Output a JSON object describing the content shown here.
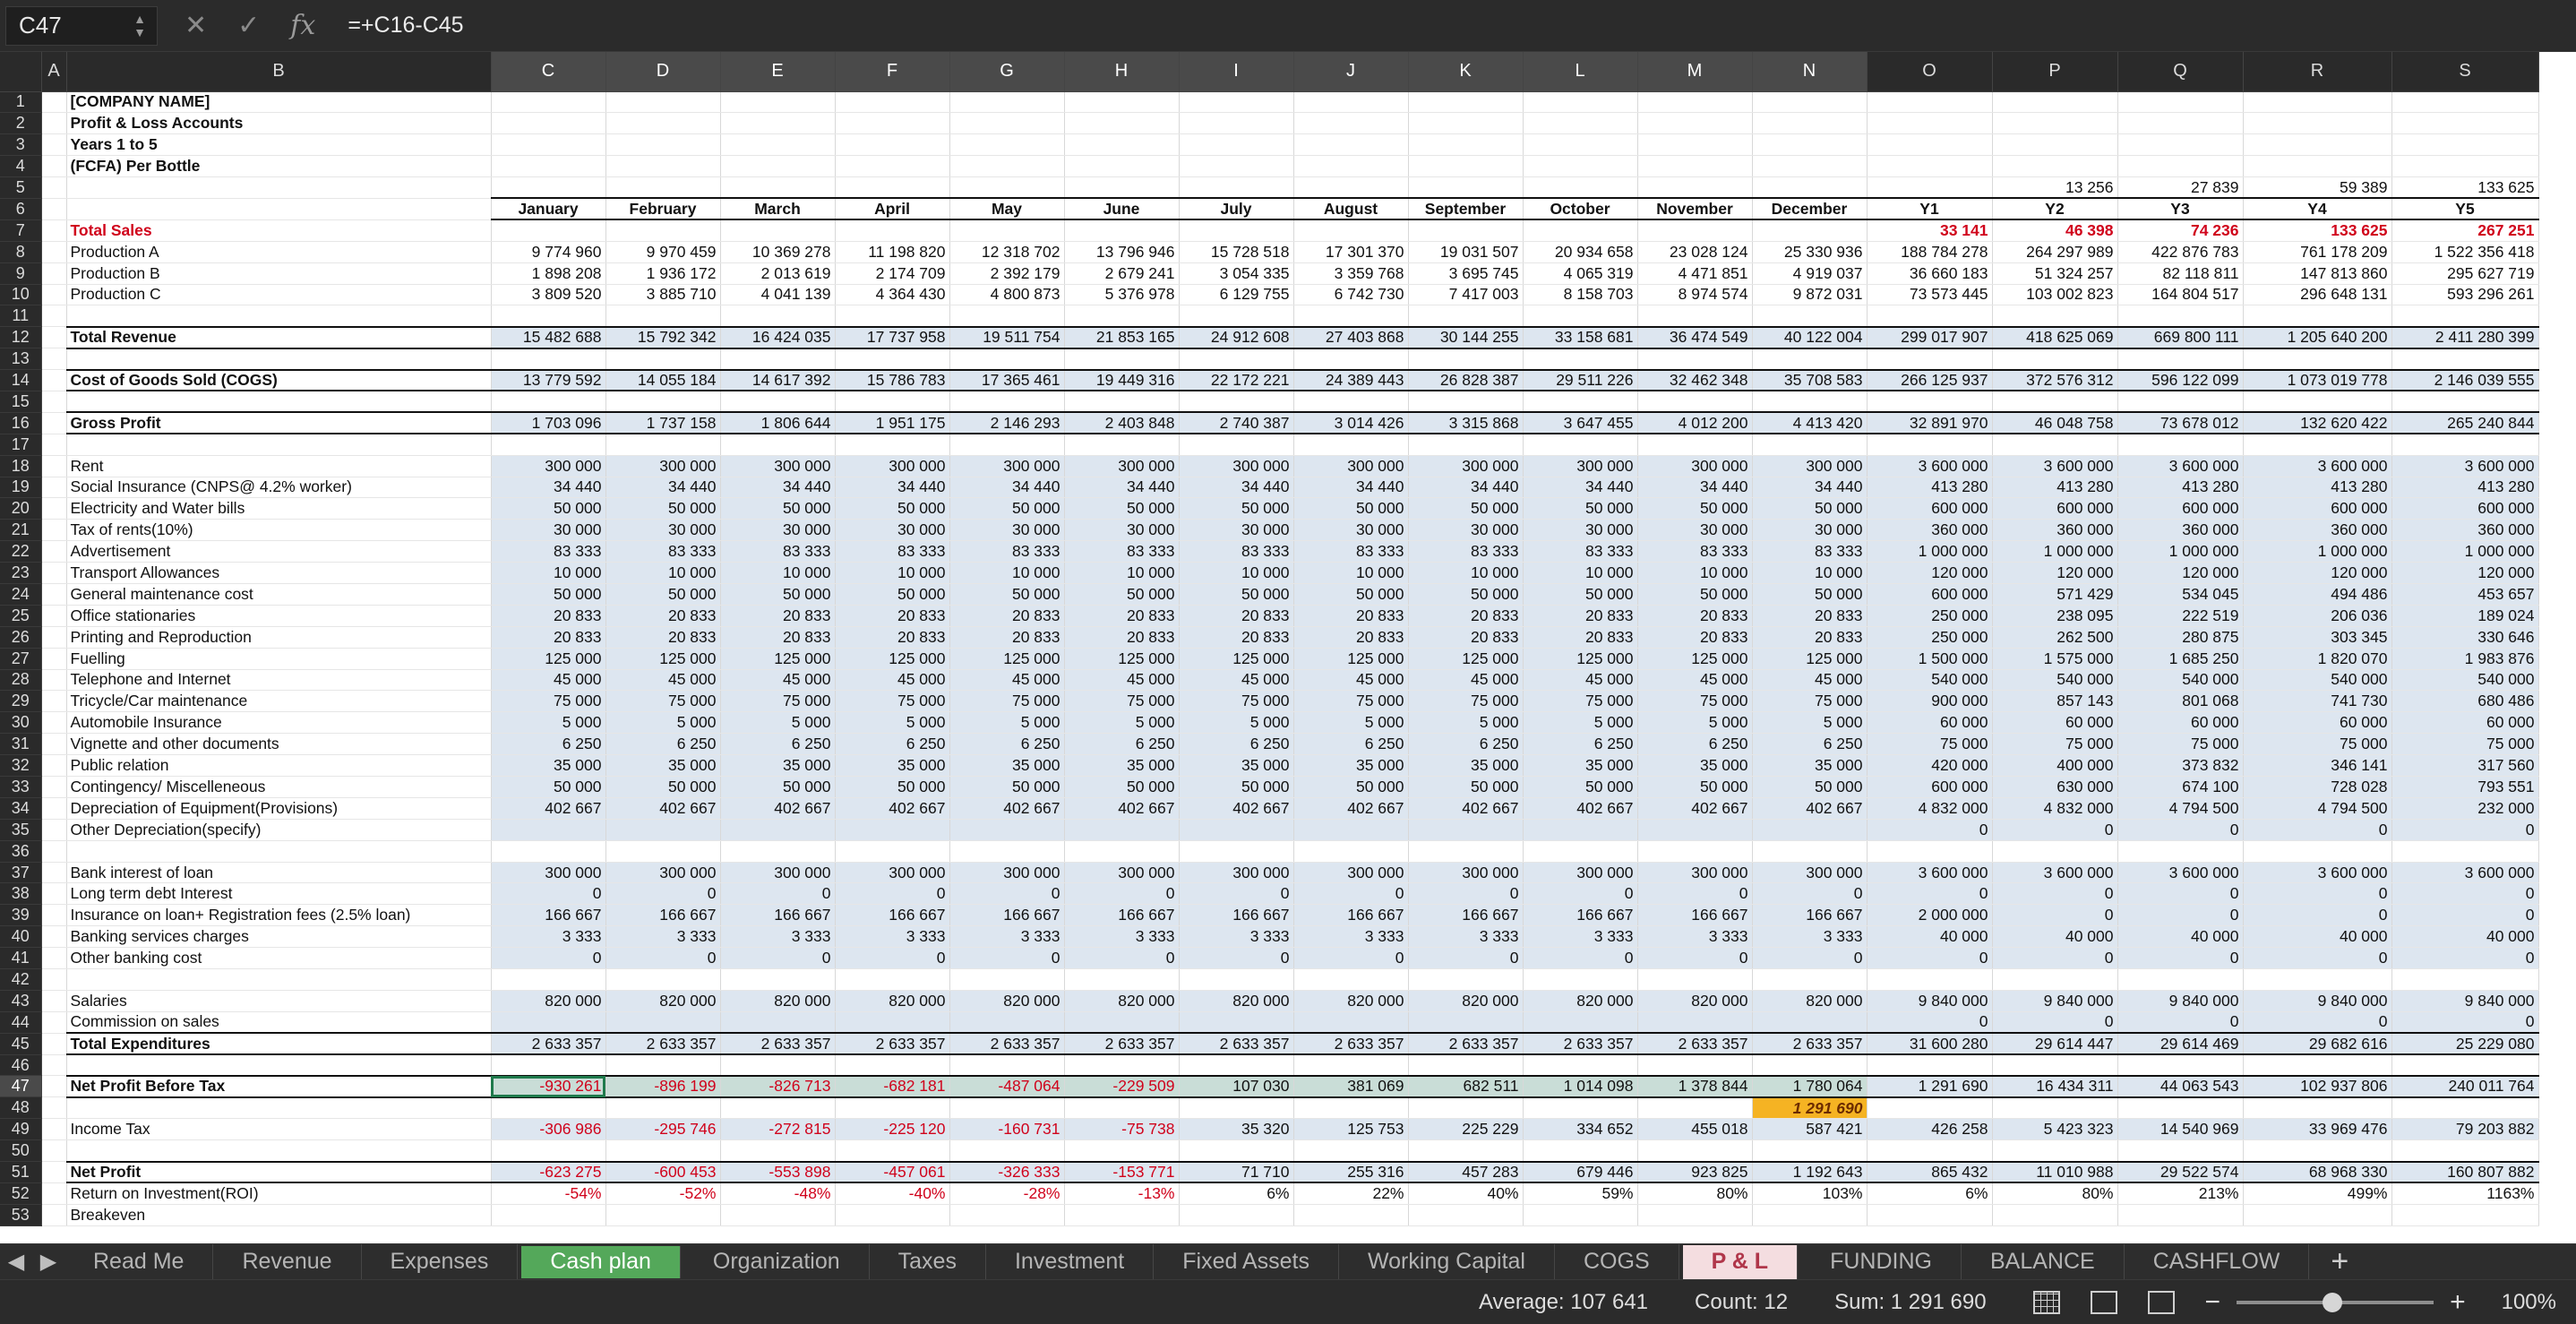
{
  "formula_bar": {
    "cell_ref": "C47",
    "formula": "=+C16-C45"
  },
  "columns": [
    "A",
    "B",
    "C",
    "D",
    "E",
    "F",
    "G",
    "H",
    "I",
    "J",
    "K",
    "L",
    "M",
    "N",
    "O",
    "P",
    "Q",
    "R",
    "S"
  ],
  "rows": [
    {
      "n": 1,
      "B": "[COMPANY NAME]"
    },
    {
      "n": 2,
      "B": "Profit & Loss Accounts"
    },
    {
      "n": 3,
      "B": "Years 1 to 5"
    },
    {
      "n": 4,
      "B": "(FCFA) Per Bottle"
    },
    {
      "n": 5,
      "B": "",
      "vals": [
        "",
        "",
        "",
        "",
        "",
        "",
        "",
        "",
        "",
        "",
        "",
        "",
        "",
        "13 256",
        "27 839",
        "59 389",
        "133 625"
      ]
    },
    {
      "n": 6,
      "B": "",
      "kind": "hdr",
      "vals": [
        "January",
        "February",
        "March",
        "April",
        "May",
        "June",
        "July",
        "August",
        "September",
        "October",
        "November",
        "December",
        "Y1",
        "Y2",
        "Y3",
        "Y4",
        "Y5"
      ]
    },
    {
      "n": 7,
      "B": "Total Sales",
      "kind": "red",
      "vals": [
        "",
        "",
        "",
        "",
        "",
        "",
        "",
        "",
        "",
        "",
        "",
        "",
        "33 141",
        "46 398",
        "74 236",
        "133 625",
        "267 251"
      ]
    },
    {
      "n": 8,
      "B": "Production A",
      "vals": [
        "9 774 960",
        "9 970 459",
        "10 369 278",
        "11 198 820",
        "12 318 702",
        "13 796 946",
        "15 728 518",
        "17 301 370",
        "19 031 507",
        "20 934 658",
        "23 028 124",
        "25 330 936",
        "188 784 278",
        "264 297 989",
        "422 876 783",
        "761 178 209",
        "1 522 356 418"
      ]
    },
    {
      "n": 9,
      "B": "Production B",
      "vals": [
        "1 898 208",
        "1 936 172",
        "2 013 619",
        "2 174 709",
        "2 392 179",
        "2 679 241",
        "3 054 335",
        "3 359 768",
        "3 695 745",
        "4 065 319",
        "4 471 851",
        "4 919 037",
        "36 660 183",
        "51 324 257",
        "82 118 811",
        "147 813 860",
        "295 627 719"
      ]
    },
    {
      "n": 10,
      "B": "Production C",
      "vals": [
        "3 809 520",
        "3 885 710",
        "4 041 139",
        "4 364 430",
        "4 800 873",
        "5 376 978",
        "6 129 755",
        "6 742 730",
        "7 417 003",
        "8 158 703",
        "8 974 574",
        "9 872 031",
        "73 573 445",
        "103 002 823",
        "164 804 517",
        "296 648 131",
        "593 296 261"
      ]
    },
    {
      "n": 11,
      "B": ""
    },
    {
      "n": 12,
      "B": "Total Revenue",
      "kind": "total",
      "vals": [
        "15 482 688",
        "15 792 342",
        "16 424 035",
        "17 737 958",
        "19 511 754",
        "21 853 165",
        "24 912 608",
        "27 403 868",
        "30 144 255",
        "33 158 681",
        "36 474 549",
        "40 122 004",
        "299 017 907",
        "418 625 069",
        "669 800 111",
        "1 205 640 200",
        "2 411 280 399"
      ]
    },
    {
      "n": 13,
      "B": ""
    },
    {
      "n": 14,
      "B": "Cost of Goods Sold (COGS)",
      "kind": "total",
      "vals": [
        "13 779 592",
        "14 055 184",
        "14 617 392",
        "15 786 783",
        "17 365 461",
        "19 449 316",
        "22 172 221",
        "24 389 443",
        "26 828 387",
        "29 511 226",
        "32 462 348",
        "35 708 583",
        "266 125 937",
        "372 576 312",
        "596 122 099",
        "1 073 019 778",
        "2 146 039 555"
      ]
    },
    {
      "n": 15,
      "B": ""
    },
    {
      "n": 16,
      "B": "Gross Profit",
      "kind": "total",
      "vals": [
        "1 703 096",
        "1 737 158",
        "1 806 644",
        "1 951 175",
        "2 146 293",
        "2 403 848",
        "2 740 387",
        "3 014 426",
        "3 315 868",
        "3 647 455",
        "4 012 200",
        "4 413 420",
        "32 891 970",
        "46 048 758",
        "73 678 012",
        "132 620 422",
        "265 240 844"
      ]
    },
    {
      "n": 17,
      "B": ""
    },
    {
      "n": 18,
      "B": "Rent",
      "kind": "exp",
      "vals": [
        "300 000",
        "300 000",
        "300 000",
        "300 000",
        "300 000",
        "300 000",
        "300 000",
        "300 000",
        "300 000",
        "300 000",
        "300 000",
        "300 000",
        "3 600 000",
        "3 600 000",
        "3 600 000",
        "3 600 000",
        "3 600 000"
      ]
    },
    {
      "n": 19,
      "B": "Social Insurance (CNPS@ 4.2% worker)",
      "kind": "exp",
      "vals": [
        "34 440",
        "34 440",
        "34 440",
        "34 440",
        "34 440",
        "34 440",
        "34 440",
        "34 440",
        "34 440",
        "34 440",
        "34 440",
        "34 440",
        "413 280",
        "413 280",
        "413 280",
        "413 280",
        "413 280"
      ]
    },
    {
      "n": 20,
      "B": "Electricity and Water bills",
      "kind": "exp",
      "vals": [
        "50 000",
        "50 000",
        "50 000",
        "50 000",
        "50 000",
        "50 000",
        "50 000",
        "50 000",
        "50 000",
        "50 000",
        "50 000",
        "50 000",
        "600 000",
        "600 000",
        "600 000",
        "600 000",
        "600 000"
      ]
    },
    {
      "n": 21,
      "B": "Tax of rents(10%)",
      "kind": "exp",
      "vals": [
        "30 000",
        "30 000",
        "30 000",
        "30 000",
        "30 000",
        "30 000",
        "30 000",
        "30 000",
        "30 000",
        "30 000",
        "30 000",
        "30 000",
        "360 000",
        "360 000",
        "360 000",
        "360 000",
        "360 000"
      ]
    },
    {
      "n": 22,
      "B": "Advertisement",
      "kind": "exp",
      "vals": [
        "83 333",
        "83 333",
        "83 333",
        "83 333",
        "83 333",
        "83 333",
        "83 333",
        "83 333",
        "83 333",
        "83 333",
        "83 333",
        "83 333",
        "1 000 000",
        "1 000 000",
        "1 000 000",
        "1 000 000",
        "1 000 000"
      ]
    },
    {
      "n": 23,
      "B": "Transport Allowances",
      "kind": "exp",
      "vals": [
        "10 000",
        "10 000",
        "10 000",
        "10 000",
        "10 000",
        "10 000",
        "10 000",
        "10 000",
        "10 000",
        "10 000",
        "10 000",
        "10 000",
        "120 000",
        "120 000",
        "120 000",
        "120 000",
        "120 000"
      ]
    },
    {
      "n": 24,
      "B": "General maintenance cost",
      "kind": "exp",
      "vals": [
        "50 000",
        "50 000",
        "50 000",
        "50 000",
        "50 000",
        "50 000",
        "50 000",
        "50 000",
        "50 000",
        "50 000",
        "50 000",
        "50 000",
        "600 000",
        "571 429",
        "534 045",
        "494 486",
        "453 657"
      ]
    },
    {
      "n": 25,
      "B": "Office stationaries",
      "kind": "exp",
      "vals": [
        "20 833",
        "20 833",
        "20 833",
        "20 833",
        "20 833",
        "20 833",
        "20 833",
        "20 833",
        "20 833",
        "20 833",
        "20 833",
        "20 833",
        "250 000",
        "238 095",
        "222 519",
        "206 036",
        "189 024"
      ]
    },
    {
      "n": 26,
      "B": "Printing and Reproduction",
      "kind": "exp",
      "vals": [
        "20 833",
        "20 833",
        "20 833",
        "20 833",
        "20 833",
        "20 833",
        "20 833",
        "20 833",
        "20 833",
        "20 833",
        "20 833",
        "20 833",
        "250 000",
        "262 500",
        "280 875",
        "303 345",
        "330 646"
      ]
    },
    {
      "n": 27,
      "B": "Fuelling",
      "kind": "exp",
      "vals": [
        "125 000",
        "125 000",
        "125 000",
        "125 000",
        "125 000",
        "125 000",
        "125 000",
        "125 000",
        "125 000",
        "125 000",
        "125 000",
        "125 000",
        "1 500 000",
        "1 575 000",
        "1 685 250",
        "1 820 070",
        "1 983 876"
      ]
    },
    {
      "n": 28,
      "B": "Telephone and Internet",
      "kind": "exp",
      "vals": [
        "45 000",
        "45 000",
        "45 000",
        "45 000",
        "45 000",
        "45 000",
        "45 000",
        "45 000",
        "45 000",
        "45 000",
        "45 000",
        "45 000",
        "540 000",
        "540 000",
        "540 000",
        "540 000",
        "540 000"
      ]
    },
    {
      "n": 29,
      "B": "Tricycle/Car maintenance",
      "kind": "exp",
      "vals": [
        "75 000",
        "75 000",
        "75 000",
        "75 000",
        "75 000",
        "75 000",
        "75 000",
        "75 000",
        "75 000",
        "75 000",
        "75 000",
        "75 000",
        "900 000",
        "857 143",
        "801 068",
        "741 730",
        "680 486"
      ]
    },
    {
      "n": 30,
      "B": "Automobile Insurance",
      "kind": "exp",
      "vals": [
        "5 000",
        "5 000",
        "5 000",
        "5 000",
        "5 000",
        "5 000",
        "5 000",
        "5 000",
        "5 000",
        "5 000",
        "5 000",
        "5 000",
        "60 000",
        "60 000",
        "60 000",
        "60 000",
        "60 000"
      ]
    },
    {
      "n": 31,
      "B": "Vignette and other documents",
      "kind": "exp",
      "vals": [
        "6 250",
        "6 250",
        "6 250",
        "6 250",
        "6 250",
        "6 250",
        "6 250",
        "6 250",
        "6 250",
        "6 250",
        "6 250",
        "6 250",
        "75 000",
        "75 000",
        "75 000",
        "75 000",
        "75 000"
      ]
    },
    {
      "n": 32,
      "B": "Public relation",
      "kind": "exp",
      "vals": [
        "35 000",
        "35 000",
        "35 000",
        "35 000",
        "35 000",
        "35 000",
        "35 000",
        "35 000",
        "35 000",
        "35 000",
        "35 000",
        "35 000",
        "420 000",
        "400 000",
        "373 832",
        "346 141",
        "317 560"
      ]
    },
    {
      "n": 33,
      "B": "Contingency/ Miscelleneous",
      "kind": "exp",
      "vals": [
        "50 000",
        "50 000",
        "50 000",
        "50 000",
        "50 000",
        "50 000",
        "50 000",
        "50 000",
        "50 000",
        "50 000",
        "50 000",
        "50 000",
        "600 000",
        "630 000",
        "674 100",
        "728 028",
        "793 551"
      ]
    },
    {
      "n": 34,
      "B": "Depreciation of Equipment(Provisions)",
      "kind": "exp",
      "vals": [
        "402 667",
        "402 667",
        "402 667",
        "402 667",
        "402 667",
        "402 667",
        "402 667",
        "402 667",
        "402 667",
        "402 667",
        "402 667",
        "402 667",
        "4 832 000",
        "4 832 000",
        "4 794 500",
        "4 794 500",
        "232 000"
      ]
    },
    {
      "n": 35,
      "B": "Other Depreciation(specify)",
      "kind": "exp",
      "vals": [
        "",
        "",
        "",
        "",
        "",
        "",
        "",
        "",
        "",
        "",
        "",
        "",
        "0",
        "0",
        "0",
        "0",
        "0"
      ]
    },
    {
      "n": 36,
      "B": ""
    },
    {
      "n": 37,
      "B": "Bank interest of loan",
      "kind": "exp",
      "vals": [
        "300 000",
        "300 000",
        "300 000",
        "300 000",
        "300 000",
        "300 000",
        "300 000",
        "300 000",
        "300 000",
        "300 000",
        "300 000",
        "300 000",
        "3 600 000",
        "3 600 000",
        "3 600 000",
        "3 600 000",
        "3 600 000"
      ]
    },
    {
      "n": 38,
      "B": "Long term debt Interest",
      "kind": "exp",
      "vals": [
        "0",
        "0",
        "0",
        "0",
        "0",
        "0",
        "0",
        "0",
        "0",
        "0",
        "0",
        "0",
        "0",
        "0",
        "0",
        "0",
        "0"
      ]
    },
    {
      "n": 39,
      "B": "Insurance on loan+ Registration fees (2.5% loan)",
      "kind": "exp",
      "vals": [
        "166 667",
        "166 667",
        "166 667",
        "166 667",
        "166 667",
        "166 667",
        "166 667",
        "166 667",
        "166 667",
        "166 667",
        "166 667",
        "166 667",
        "2 000 000",
        "0",
        "0",
        "0",
        "0"
      ]
    },
    {
      "n": 40,
      "B": "Banking services charges",
      "kind": "exp",
      "vals": [
        "3 333",
        "3 333",
        "3 333",
        "3 333",
        "3 333",
        "3 333",
        "3 333",
        "3 333",
        "3 333",
        "3 333",
        "3 333",
        "3 333",
        "40 000",
        "40 000",
        "40 000",
        "40 000",
        "40 000"
      ]
    },
    {
      "n": 41,
      "B": "Other banking cost",
      "kind": "exp",
      "vals": [
        "0",
        "0",
        "0",
        "0",
        "0",
        "0",
        "0",
        "0",
        "0",
        "0",
        "0",
        "0",
        "0",
        "0",
        "0",
        "0",
        "0"
      ]
    },
    {
      "n": 42,
      "B": ""
    },
    {
      "n": 43,
      "B": "Salaries",
      "kind": "exp",
      "vals": [
        "820 000",
        "820 000",
        "820 000",
        "820 000",
        "820 000",
        "820 000",
        "820 000",
        "820 000",
        "820 000",
        "820 000",
        "820 000",
        "820 000",
        "9 840 000",
        "9 840 000",
        "9 840 000",
        "9 840 000",
        "9 840 000"
      ]
    },
    {
      "n": 44,
      "B": "Commission on sales",
      "kind": "exp",
      "vals": [
        "",
        "",
        "",
        "",
        "",
        "",
        "",
        "",
        "",
        "",
        "",
        "",
        "0",
        "0",
        "0",
        "0",
        "0"
      ]
    },
    {
      "n": 45,
      "B": "Total  Expenditures",
      "kind": "total",
      "vals": [
        "2 633 357",
        "2 633 357",
        "2 633 357",
        "2 633 357",
        "2 633 357",
        "2 633 357",
        "2 633 357",
        "2 633 357",
        "2 633 357",
        "2 633 357",
        "2 633 357",
        "2 633 357",
        "31 600 280",
        "29 614 447",
        "29 614 469",
        "29 682 616",
        "25 229 080"
      ]
    },
    {
      "n": 46,
      "B": ""
    },
    {
      "n": 47,
      "B": "Net Profit Before Tax",
      "kind": "net",
      "vals": [
        "-930 261",
        "-896 199",
        "-826 713",
        "-682 181",
        "-487 064",
        "-229 509",
        "107 030",
        "381 069",
        "682 511",
        "1 014 098",
        "1 378 844",
        "1 780 064",
        "1 291 690",
        "16 434 311",
        "44 063 543",
        "102 937 806",
        "240 011 764"
      ]
    },
    {
      "n": 48,
      "B": "",
      "kind": "note",
      "vals": [
        "",
        "",
        "",
        "",
        "",
        "",
        "",
        "",
        "",
        "",
        "",
        "1 291 690",
        "",
        "",
        "",
        "",
        ""
      ]
    },
    {
      "n": 49,
      "B": "Income Tax",
      "kind": "exp",
      "vals": [
        "-306 986",
        "-295 746",
        "-272 815",
        "-225 120",
        "-160 731",
        "-75 738",
        "35 320",
        "125 753",
        "225 229",
        "334 652",
        "455 018",
        "587 421",
        "426 258",
        "5 423 323",
        "14 540 969",
        "33 969 476",
        "79 203 882"
      ]
    },
    {
      "n": 50,
      "B": ""
    },
    {
      "n": 51,
      "B": "Net Profit",
      "kind": "total",
      "vals": [
        "-623 275",
        "-600 453",
        "-553 898",
        "-457 061",
        "-326 333",
        "-153 771",
        "71 710",
        "255 316",
        "457 283",
        "679 446",
        "923 825",
        "1 192 643",
        "865 432",
        "11 010 988",
        "29 522 574",
        "68 968 330",
        "160 807 882"
      ]
    },
    {
      "n": 52,
      "B": "Return on Investment(ROI)",
      "kind": "roi",
      "vals": [
        "-54%",
        "-52%",
        "-48%",
        "-40%",
        "-28%",
        "-13%",
        "6%",
        "22%",
        "40%",
        "59%",
        "80%",
        "103%",
        "6%",
        "80%",
        "213%",
        "499%",
        "1163%"
      ]
    },
    {
      "n": 53,
      "B": "Breakeven",
      "vals": []
    }
  ],
  "tabs": [
    "Read Me",
    "Revenue",
    "Expenses",
    "Cash plan",
    "Organization",
    "Taxes",
    "Investment",
    "Fixed Assets",
    "Working Capital",
    "COGS",
    "P & L",
    "FUNDING",
    "BALANCE",
    "CASHFLOW"
  ],
  "active_tab": "P & L",
  "status": {
    "average": "Average: 107 641",
    "count": "Count: 12",
    "sum": "Sum: 1 291 690",
    "zoom": "100%"
  },
  "colors": {
    "accent_green": "#1f7a4c",
    "negative_red": "#d0021b",
    "shade_blue": "#dde6f0",
    "highlight_orange": "#f5b323",
    "active_tab_text": "#b0364a"
  }
}
